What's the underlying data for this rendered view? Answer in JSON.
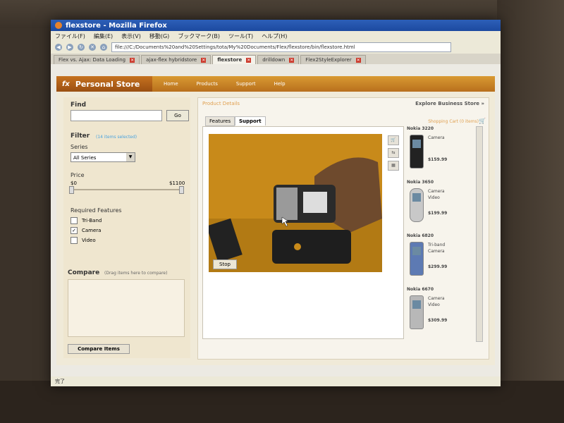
{
  "window": {
    "title": "flexstore - Mozilla Firefox"
  },
  "menu": [
    "ファイル(F)",
    "編集(E)",
    "表示(V)",
    "移動(G)",
    "ブックマーク(B)",
    "ツール(T)",
    "ヘルプ(H)"
  ],
  "address": {
    "url": "file:///C:/Documents%20and%20Settings/tota/My%20Documents/Flex/flexstore/bin/flexstore.html"
  },
  "tabs": [
    {
      "label": "Flex vs. Ajax: Data Loading",
      "active": false
    },
    {
      "label": "ajax-flex hybridstore",
      "active": false
    },
    {
      "label": "flexstore",
      "active": true
    },
    {
      "label": "drilldown",
      "active": false
    },
    {
      "label": "Flex2StyleExplorer",
      "active": false
    }
  ],
  "app": {
    "logo_text": "Personal Store",
    "logo_symbol": "fx",
    "nav": [
      "Home",
      "Products",
      "Support",
      "Help"
    ]
  },
  "filter": {
    "find_label": "Find",
    "find_value": "",
    "go_label": "Go",
    "filter_label": "Filter",
    "selected_text": "(14 items selected)",
    "series_label": "Series",
    "series_value": "All Series",
    "price_label": "Price",
    "price_min": "$0",
    "price_max": "$1100",
    "features_label": "Required Features",
    "features": [
      {
        "label": "Tri-Band",
        "checked": false
      },
      {
        "label": "Camera",
        "checked": true
      },
      {
        "label": "Video",
        "checked": false
      }
    ],
    "compare_label": "Compare",
    "compare_hint": "(Drag items here to compare)",
    "compare_button": "Compare Items"
  },
  "details": {
    "panel_title": "Product Details",
    "explore_title": "Explore Business Store »",
    "cart_label": "Shopping Cart (0 items)",
    "tabs": [
      "Features",
      "Support"
    ],
    "active_tab": "Support",
    "stop_label": "Stop"
  },
  "products": [
    {
      "name": "Nokia 3220",
      "features": [
        "Camera"
      ],
      "price": "$159.99"
    },
    {
      "name": "Nokia 3650",
      "features": [
        "Camera",
        "Video"
      ],
      "price": "$199.99"
    },
    {
      "name": "Nokia 6820",
      "features": [
        "Tri-band",
        "Camera"
      ],
      "price": "$299.99"
    },
    {
      "name": "Nokia 6670",
      "features": [
        "Camera",
        "Video"
      ],
      "price": "$309.99"
    }
  ],
  "status": {
    "text": "完了"
  }
}
